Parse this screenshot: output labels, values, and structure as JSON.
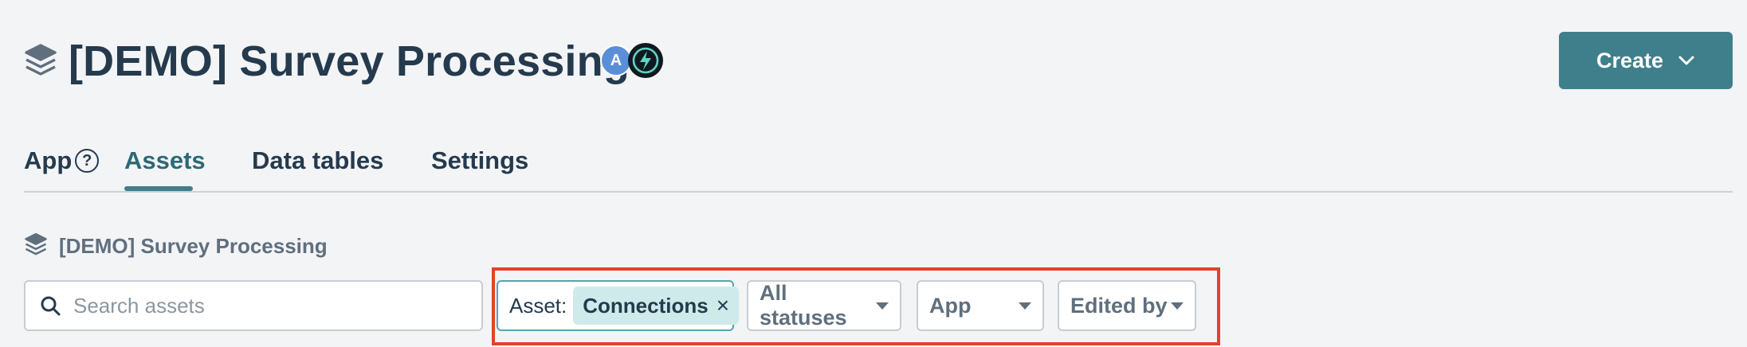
{
  "header": {
    "title": "[DEMO] Survey Processing",
    "avatar_letter": "A",
    "create_label": "Create"
  },
  "tabs": [
    {
      "label": "App"
    },
    {
      "label": "Assets",
      "active": true
    },
    {
      "label": "Data tables"
    },
    {
      "label": "Settings"
    }
  ],
  "help_glyph": "?",
  "breadcrumb": {
    "label": "[DEMO] Survey Processing"
  },
  "search": {
    "placeholder": "Search assets",
    "value": ""
  },
  "filters": {
    "asset_prefix": "Asset:",
    "asset_chip": "Connections",
    "chip_close": "×",
    "status": "All statuses",
    "app": "App",
    "edited_by": "Edited by"
  },
  "colors": {
    "accent": "#3f7f8c",
    "highlight": "#e0442b",
    "chip_bg": "#cfeaea",
    "text": "#253a4d"
  },
  "icons": [
    "stack-icon",
    "lightning-icon",
    "chevron-down-icon",
    "help-icon",
    "search-icon",
    "close-icon",
    "caret-down-icon"
  ]
}
